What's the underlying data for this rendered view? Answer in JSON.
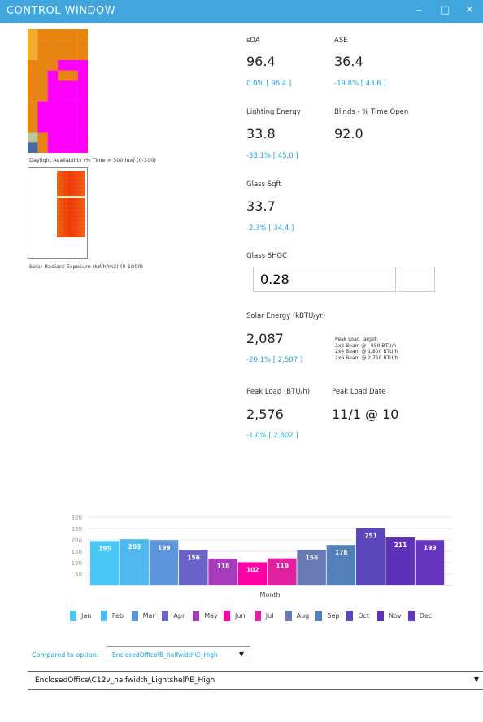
{
  "window": {
    "title": "CONTROL WINDOW",
    "controls": {
      "minimize": "–",
      "maximize": "□",
      "close": "✕"
    }
  },
  "heatmaps": {
    "daylight": {
      "caption": "Daylight Availability (% Time > 300 lux) (0-100)",
      "columns": 6,
      "rows": 12,
      "palette": {
        "O": "#e88512",
        "Y": "#f2ac2c",
        "M": "#ff00ff",
        "G": "#b9c79c",
        "B": "#4a6aa0"
      },
      "cells": [
        "YOOOOO",
        "YOOOOO",
        "YOOOOO",
        "OOOMMM",
        "OOMOOM",
        "OOMMMM",
        "OOMMMM",
        "OMMMMM",
        "OMMMMM",
        "OMMMMM",
        "GOMMMM",
        "BOMMMM"
      ]
    },
    "solar": {
      "caption": "Solar Radiant Exposure (kWh/m2) (0-1000)"
    }
  },
  "metrics": {
    "sda": {
      "label": "sDA",
      "value": "96.4",
      "delta": "0.0% [ 96.4 ]"
    },
    "ase": {
      "label": "ASE",
      "value": "36.4",
      "delta": "-19.8% [ 43.6 ]"
    },
    "lighting": {
      "label": "Lighting Energy",
      "value": "33.8",
      "delta": "-33.1% [ 45.0 ]"
    },
    "blinds": {
      "label": "Blinds - % Time Open",
      "value": "92.0"
    },
    "glass_sqft": {
      "label": "Glass Sqft",
      "value": "33.7",
      "delta": "-2.3% [ 34.4 ]"
    },
    "glass_shgc": {
      "label": "Glass SHGC",
      "value": "0.28"
    },
    "solar_energy": {
      "label": "Solar Energy (kBTU/yr)",
      "value": "2,087",
      "delta": "-20.1% [ 2,507 ]"
    },
    "peak_target": {
      "title": "Peak Load Target:",
      "lines": [
        "2x2 Beam @   950 BTU/h",
        "2x4 Beam @ 1,800 BTU/h",
        "2x6 Beam @ 2,750 BTU/h"
      ]
    },
    "peak_load": {
      "label": "Peak Load (BTU/h)",
      "value": "2,576",
      "delta": "-1.0% [ 2,602 ]"
    },
    "peak_date": {
      "label": "Peak Load Date",
      "value": "11/1 @ 10"
    }
  },
  "chart_data": {
    "type": "bar",
    "categories": [
      "Jan",
      "Feb",
      "Mar",
      "Apr",
      "May",
      "Jun",
      "Jul",
      "Aug",
      "Sep",
      "Oct",
      "Nov",
      "Dec"
    ],
    "values": [
      195,
      203,
      199,
      156,
      118,
      102,
      119,
      156,
      178,
      251,
      211,
      199
    ],
    "colors": [
      "#47c8f5",
      "#4fb8ee",
      "#5e94dc",
      "#6a63c8",
      "#a63cba",
      "#ff00a8",
      "#e0209e",
      "#6879b4",
      "#5480ba",
      "#5b46bb",
      "#5e31b8",
      "#6535be"
    ],
    "yticks": [
      50,
      100,
      150,
      200,
      250,
      300
    ],
    "ylim": [
      0,
      300
    ],
    "xlabel": "Month",
    "ylabel": "",
    "grid": true,
    "legend": "bottom"
  },
  "comparison": {
    "label": "Compared to option:",
    "selected": "EnclosedOffice\\B_halfwidth\\E_High"
  },
  "current_option": {
    "selected": "EnclosedOffice\\C12v_halfwidth_Lightshelf\\E_High"
  }
}
